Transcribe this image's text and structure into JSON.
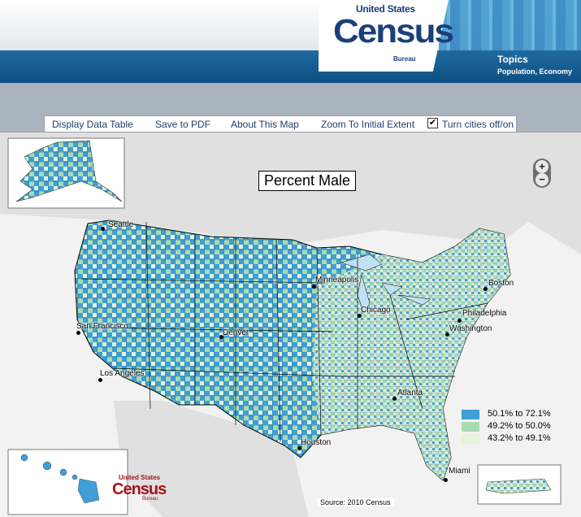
{
  "header": {
    "logo_top": "United States",
    "logo_main": "Census",
    "logo_bureau": "Bureau",
    "topics_title": "Topics",
    "topics_sub": "Population, Economy"
  },
  "toolbar": {
    "display_data_table": "Display Data Table",
    "save_to_pdf": "Save to PDF",
    "about_map": "About This Map",
    "zoom_extent": "Zoom To Initial Extent",
    "cities_checkbox_checked": true,
    "cities_label": "Turn cities off/on"
  },
  "map": {
    "title": "Percent Male",
    "source": "Source:  2010 Census",
    "zoom_in": "+",
    "zoom_out": "−",
    "cities": [
      "Seattle",
      "San Francisco",
      "Los Angeles",
      "Denver",
      "Minneapolis",
      "Chicago",
      "Boston",
      "Philadelphia",
      "Washington",
      "Atlanta",
      "Houston",
      "Miami"
    ],
    "legend": [
      {
        "label": "50.1% to 72.1%",
        "color": "#3f9fd6"
      },
      {
        "label": "49.2% to 50.0%",
        "color": "#a8dcb0"
      },
      {
        "label": "43.2% to 49.1%",
        "color": "#e6f3dc"
      }
    ],
    "mini_logo_top": "United States",
    "mini_logo_main": "Census",
    "mini_logo_bureau": "Bureau"
  }
}
